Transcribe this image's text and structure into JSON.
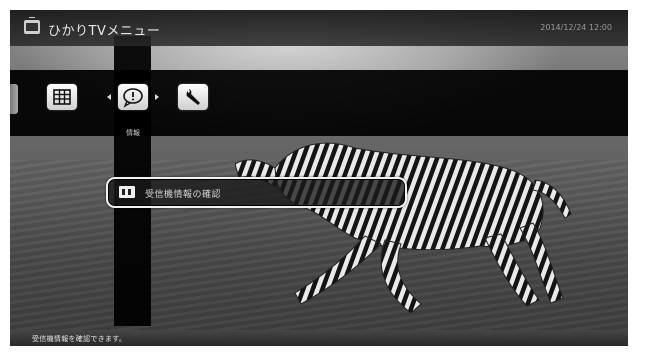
{
  "window": {
    "title": "ひかりTVメニュー",
    "clock": "2014/12/24 12:00"
  },
  "toolbar": {
    "items": [
      {
        "icon": "program-guide-grid-icon"
      },
      {
        "icon": "information-icon",
        "label": "情報"
      },
      {
        "icon": "wrench-settings-icon"
      }
    ]
  },
  "submenu": {
    "items": [
      {
        "icon": "tuner-icon",
        "label": "受信機情報の確認"
      }
    ]
  },
  "statusbar": {
    "help_text": "受信機情報を確認できます。"
  },
  "colors": {
    "accent_highlight": "#f2f2f2",
    "panel": "#000000"
  }
}
